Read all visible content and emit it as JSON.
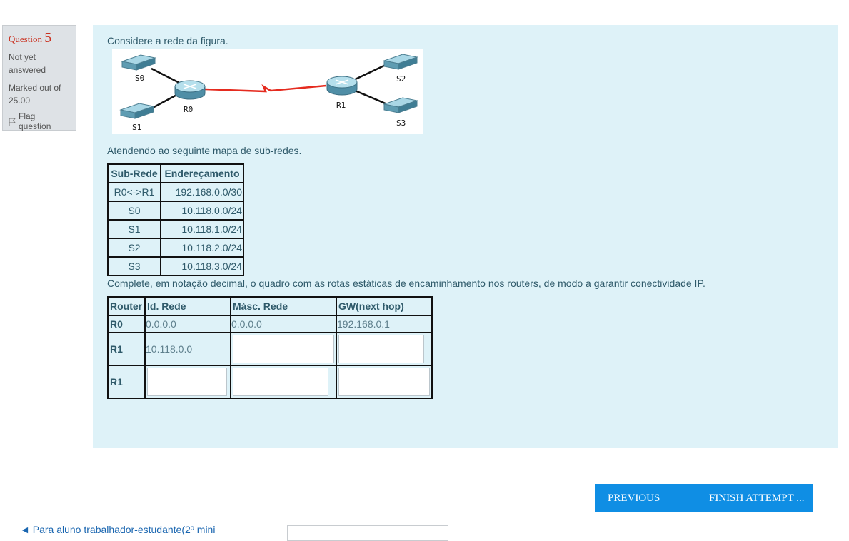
{
  "question_info": {
    "label": "Question",
    "number": "5",
    "state": "Not yet answered",
    "grade": "Marked out of 25.00",
    "flag_label": "Flag question"
  },
  "question": {
    "intro": "Considere a rede da figura.",
    "diagram_labels": {
      "s0": "S0",
      "s1": "S1",
      "s2": "S2",
      "s3": "S3",
      "r0": "R0",
      "r1": "R1"
    },
    "subnet_intro": "Atendendo ao seguinte mapa de sub-redes.",
    "subnet_table": {
      "headers": [
        "Sub-Rede",
        "Endereçamento"
      ],
      "rows": [
        [
          "R0<->R1",
          "192.168.0.0/30"
        ],
        [
          "S0",
          "10.118.0.0/24"
        ],
        [
          "S1",
          "10.118.1.0/24"
        ],
        [
          "S2",
          "10.118.2.0/24"
        ],
        [
          "S3",
          "10.118.3.0/24"
        ]
      ]
    },
    "instruction": "Complete, em notação decimal, o quadro com as rotas estáticas de encaminhamento nos routers, de modo a garantir conectividade IP.",
    "route_table": {
      "headers": [
        "Router",
        "Id. Rede",
        "Másc. Rede",
        "GW(next hop)"
      ],
      "row0": {
        "router": "R0",
        "id": "0.0.0.0",
        "mask": "0.0.0.0",
        "gw": "192.168.0.1"
      },
      "row1": {
        "router": "R1",
        "id": "10.118.0.0",
        "mask": "",
        "gw": ""
      },
      "row2": {
        "router": "R1",
        "id": "",
        "mask": "",
        "gw": ""
      }
    }
  },
  "nav": {
    "previous_label": "PREVIOUS PAGE",
    "finish_label": "FINISH ATTEMPT ...",
    "prev_activity_link": "◄ Para aluno trabalhador-estudante(2º mini",
    "accent_color": "#0f8ee4"
  }
}
